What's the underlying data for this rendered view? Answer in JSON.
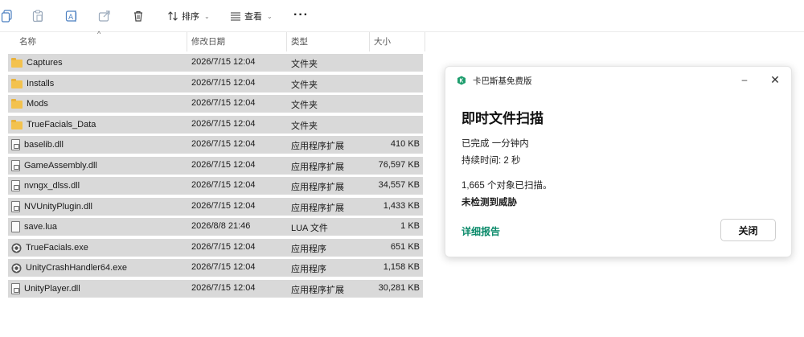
{
  "toolbar": {
    "sort_label": "排序",
    "view_label": "查看",
    "more_label": "···"
  },
  "columns": {
    "name": "名称",
    "modified": "修改日期",
    "type": "类型",
    "size": "大小"
  },
  "files": [
    {
      "name": "Captures",
      "modified": "2026/7/15 12:04",
      "type": "文件夹",
      "size": "",
      "icon": "folder-icon"
    },
    {
      "name": "Installs",
      "modified": "2026/7/15 12:04",
      "type": "文件夹",
      "size": "",
      "icon": "folder-icon"
    },
    {
      "name": "Mods",
      "modified": "2026/7/15 12:04",
      "type": "文件夹",
      "size": "",
      "icon": "folder-icon"
    },
    {
      "name": "TrueFacials_Data",
      "modified": "2026/7/15 12:04",
      "type": "文件夹",
      "size": "",
      "icon": "folder-icon"
    },
    {
      "name": "baselib.dll",
      "modified": "2026/7/15 12:04",
      "type": "应用程序扩展",
      "size": "410 KB",
      "icon": "dll-icon"
    },
    {
      "name": "GameAssembly.dll",
      "modified": "2026/7/15 12:04",
      "type": "应用程序扩展",
      "size": "76,597 KB",
      "icon": "dll-icon"
    },
    {
      "name": "nvngx_dlss.dll",
      "modified": "2026/7/15 12:04",
      "type": "应用程序扩展",
      "size": "34,557 KB",
      "icon": "dll-icon"
    },
    {
      "name": "NVUnityPlugin.dll",
      "modified": "2026/7/15 12:04",
      "type": "应用程序扩展",
      "size": "1,433 KB",
      "icon": "dll-icon"
    },
    {
      "name": "save.lua",
      "modified": "2026/8/8 21:46",
      "type": "LUA 文件",
      "size": "1 KB",
      "icon": "document-icon"
    },
    {
      "name": "TrueFacials.exe",
      "modified": "2026/7/15 12:04",
      "type": "应用程序",
      "size": "651 KB",
      "icon": "unity-app-icon"
    },
    {
      "name": "UnityCrashHandler64.exe",
      "modified": "2026/7/15 12:04",
      "type": "应用程序",
      "size": "1,158 KB",
      "icon": "unity-app-icon"
    },
    {
      "name": "UnityPlayer.dll",
      "modified": "2026/7/15 12:04",
      "type": "应用程序扩展",
      "size": "30,281 KB",
      "icon": "dll-icon"
    }
  ],
  "notification": {
    "app_name": "卡巴斯基免费版",
    "minimize": "–",
    "close_glyph": "✕",
    "title": "即时文件扫描",
    "status": "已完成 一分钟内",
    "duration": "持续时间: 2 秒",
    "scanned": "1,665 个对象已扫描。",
    "result": "未检测到威胁",
    "report_link": "详细报告",
    "close_button": "关闭",
    "accent_color": "#0a8a6a"
  }
}
